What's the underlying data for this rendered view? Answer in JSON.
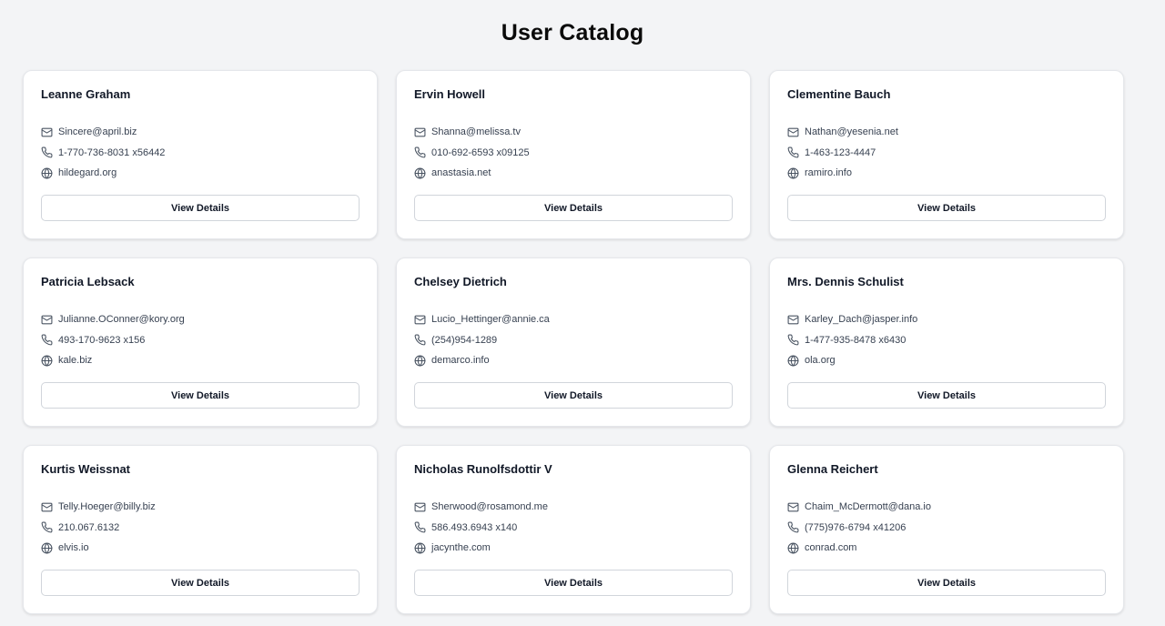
{
  "page": {
    "title": "User Catalog"
  },
  "button_label": "View Details",
  "users": [
    {
      "name": "Leanne Graham",
      "email": "Sincere@april.biz",
      "phone": "1-770-736-8031 x56442",
      "website": "hildegard.org"
    },
    {
      "name": "Ervin Howell",
      "email": "Shanna@melissa.tv",
      "phone": "010-692-6593 x09125",
      "website": "anastasia.net"
    },
    {
      "name": "Clementine Bauch",
      "email": "Nathan@yesenia.net",
      "phone": "1-463-123-4447",
      "website": "ramiro.info"
    },
    {
      "name": "Patricia Lebsack",
      "email": "Julianne.OConner@kory.org",
      "phone": "493-170-9623 x156",
      "website": "kale.biz"
    },
    {
      "name": "Chelsey Dietrich",
      "email": "Lucio_Hettinger@annie.ca",
      "phone": "(254)954-1289",
      "website": "demarco.info"
    },
    {
      "name": "Mrs. Dennis Schulist",
      "email": "Karley_Dach@jasper.info",
      "phone": "1-477-935-8478 x6430",
      "website": "ola.org"
    },
    {
      "name": "Kurtis Weissnat",
      "email": "Telly.Hoeger@billy.biz",
      "phone": "210.067.6132",
      "website": "elvis.io"
    },
    {
      "name": "Nicholas Runolfsdottir V",
      "email": "Sherwood@rosamond.me",
      "phone": "586.493.6943 x140",
      "website": "jacynthe.com"
    },
    {
      "name": "Glenna Reichert",
      "email": "Chaim_McDermott@dana.io",
      "phone": "(775)976-6794 x41206",
      "website": "conrad.com"
    }
  ],
  "icons": {
    "email": "mail-icon",
    "phone": "phone-icon",
    "website": "globe-icon"
  },
  "colors": {
    "background": "#f3f4f6",
    "card": "#ffffff",
    "icon": "#4b5563"
  }
}
